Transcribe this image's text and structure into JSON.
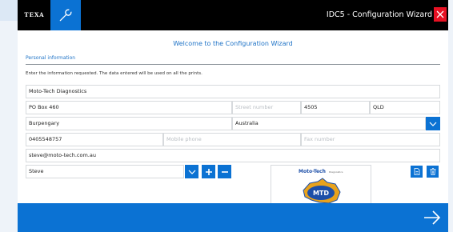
{
  "titlebar": {
    "logo_text": "TEXA",
    "title": "IDC5 - Configuration Wizard"
  },
  "header": {
    "welcome": "Welcome to the Configuration Wizard"
  },
  "section": {
    "label": "Personal information",
    "instructions": "Enter the information requested. The data entered will be used on all the prints."
  },
  "form": {
    "company": {
      "value": "Moto-Tech Diagnostics",
      "placeholder": ""
    },
    "address": {
      "value": "PO Box 460",
      "placeholder": ""
    },
    "street_number": {
      "value": "",
      "placeholder": "Street number"
    },
    "postcode": {
      "value": "4505",
      "placeholder": ""
    },
    "state": {
      "value": "QLD",
      "placeholder": ""
    },
    "city": {
      "value": "Burpengary",
      "placeholder": ""
    },
    "country": {
      "value": "Australia",
      "placeholder": ""
    },
    "phone": {
      "value": "0405548757",
      "placeholder": ""
    },
    "mobile": {
      "value": "",
      "placeholder": "Mobile phone"
    },
    "fax": {
      "value": "",
      "placeholder": "Fax number"
    },
    "email": {
      "value": "steve@moto-tech.com.au",
      "placeholder": ""
    },
    "operator": {
      "value": "Steve"
    }
  },
  "logo": {
    "title": "Moto-Tech",
    "subtitle": "Diagnostics",
    "emblem": "MTD"
  },
  "icons": {
    "tool": "wrench-icon",
    "close": "close-icon",
    "dropdown": "chevron-down-icon",
    "add": "plus-icon",
    "remove": "minus-icon",
    "open_file": "document-icon",
    "delete": "trash-icon",
    "next": "arrow-right-icon"
  },
  "colors": {
    "accent": "#0b72d3",
    "titlebar": "#000000",
    "close": "#e81123",
    "heading": "#1d72c6"
  }
}
